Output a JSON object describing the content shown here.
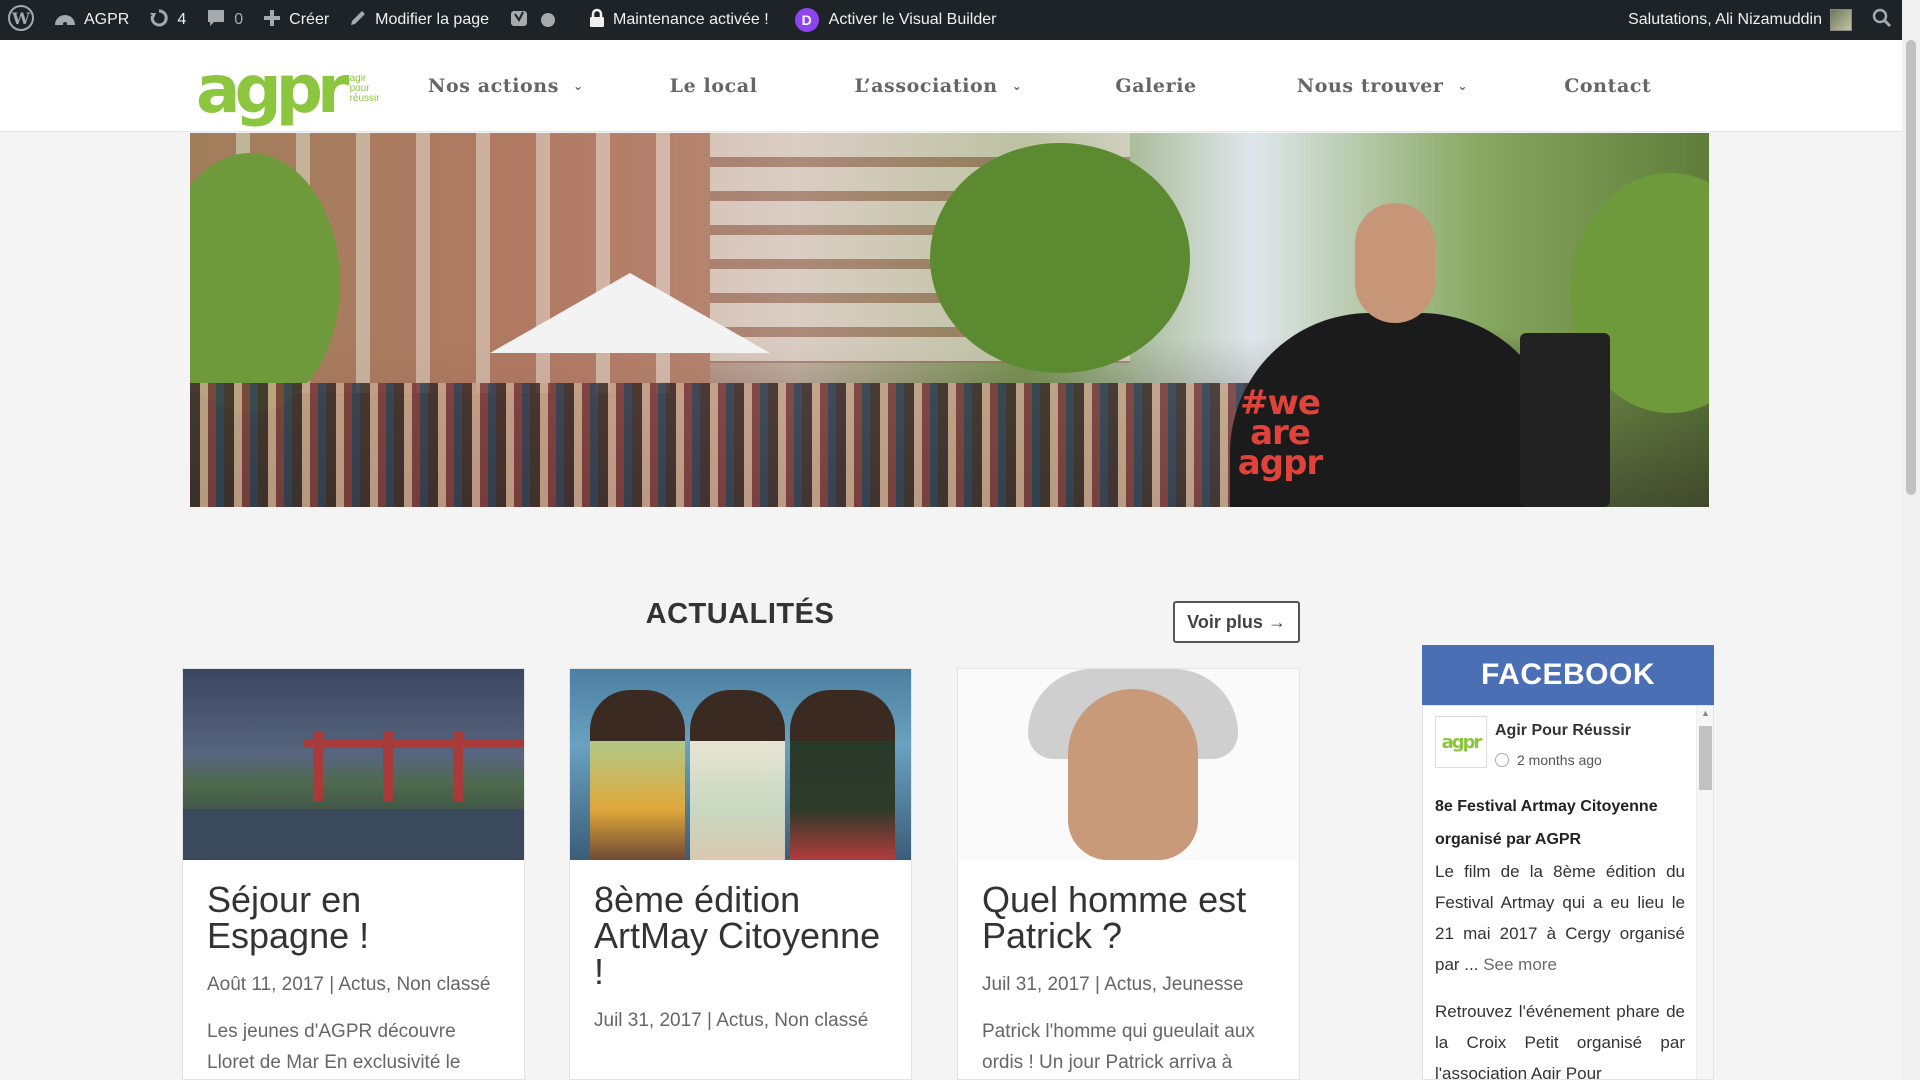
{
  "adminbar": {
    "site_name": "AGPR",
    "updates_count": "4",
    "comments_count": "0",
    "create_label": "Créer",
    "edit_page_label": "Modifier la page",
    "maintenance_label": "Maintenance activée !",
    "visual_builder_label": "Activer le Visual Builder",
    "divi_badge": "D",
    "greeting": "Salutations, Ali Nizamuddin"
  },
  "header": {
    "logo_text": "agpr",
    "logo_tagline": [
      "agir",
      "pour",
      "réussir"
    ],
    "nav": [
      {
        "label": "Nos actions",
        "has_dropdown": true
      },
      {
        "label": "Le local",
        "has_dropdown": false
      },
      {
        "label": "L’association",
        "has_dropdown": true
      },
      {
        "label": "Galerie",
        "has_dropdown": false
      },
      {
        "label": "Nous trouver",
        "has_dropdown": true
      },
      {
        "label": "Contact",
        "has_dropdown": false
      }
    ]
  },
  "hero": {
    "shirt_text": "#we are agpr"
  },
  "news": {
    "title": "ACTUALITÉS",
    "more_button": "Voir plus →",
    "posts": [
      {
        "title": "Séjour en Espagne !",
        "date": "Août 11, 2017",
        "categories": "Actus, Non classé",
        "excerpt": "Les jeunes d'AGPR découvre Lloret de Mar En exclusivité le planning des jeunes d'AGPR en"
      },
      {
        "title": "8ème édition ArtMay Citoyenne !",
        "date": "Juil 31, 2017",
        "categories": "Actus, Non classé",
        "excerpt": ""
      },
      {
        "title": "Quel homme est Patrick ?",
        "date": "Juil 31, 2017",
        "categories": "Actus, Jeunesse",
        "excerpt": "Patrick l'homme qui gueulait aux ordis ! Un jour Patrick arriva à l'école du Web il tomba sur"
      }
    ]
  },
  "facebook": {
    "heading": "FACEBOOK",
    "page_name": "Agir Pour Réussir",
    "avatar_text": "agpr",
    "time_ago": "2 months ago",
    "post_title": "8e Festival Artmay Citoyenne organisé par AGPR",
    "post_text": "Le film de la 8ème édition du Festival Artmay qui a eu lieu le 21 mai 2017 à Cergy organisé par ...",
    "see_more": "See more",
    "post2_text": "Retrouvez l'événement phare de la Croix Petit organisé par l'association Agir Pour"
  },
  "colors": {
    "adminbar_bg": "#1d2327",
    "brand_green": "#8cc63f",
    "facebook_blue": "#4a6fb5",
    "divi_purple": "#8e44ec"
  }
}
